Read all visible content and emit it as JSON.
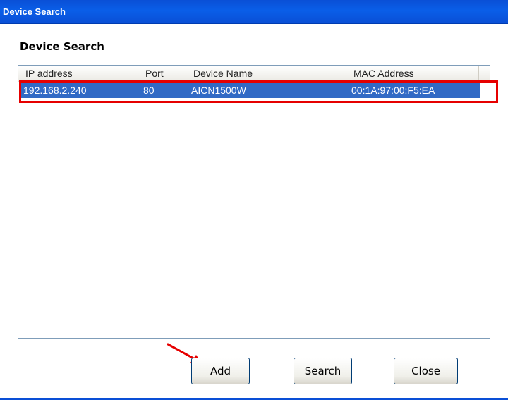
{
  "window": {
    "title": "Device Search"
  },
  "dialog": {
    "heading": "Device Search"
  },
  "table": {
    "columns": [
      "IP address",
      "Port",
      "Device Name",
      "MAC Address"
    ],
    "rows": [
      {
        "ip": "192.168.2.240",
        "port": "80",
        "device_name": "AICN1500W",
        "mac": "00:1A:97:00:F5:EA",
        "selected": true
      }
    ]
  },
  "buttons": {
    "add": "Add",
    "search": "Search",
    "close": "Close"
  },
  "annotations": {
    "highlight_color": "#e60000",
    "arrow_icon": "red-arrow-icon",
    "selection_color": "#316ac5",
    "titlebar_color": "#0a4fd6"
  }
}
